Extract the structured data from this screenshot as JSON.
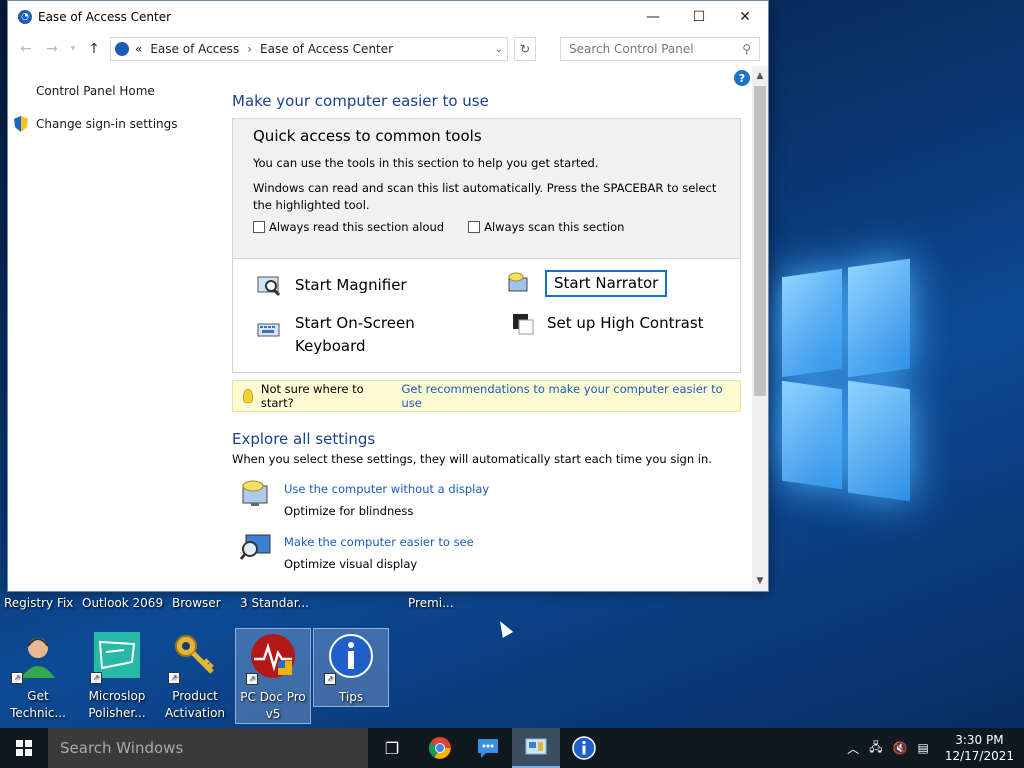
{
  "window": {
    "title": "Ease of Access Center",
    "minimize_icon": "—",
    "maximize_icon": "☐",
    "close_icon": "✕"
  },
  "address": {
    "prefix": "«",
    "crumbs": [
      "Ease of Access",
      "Ease of Access Center"
    ],
    "crumb_sep": "›",
    "search_placeholder": "Search Control Panel"
  },
  "leftnav": {
    "items": [
      {
        "label": "Control Panel Home"
      },
      {
        "label": "Change sign-in settings"
      }
    ]
  },
  "main": {
    "title": "Make your computer easier to use",
    "quick": {
      "heading": "Quick access to common tools",
      "p1": "You can use the tools in this section to help you get started.",
      "p2": "Windows can read and scan this list automatically.  Press the SPACEBAR to select the highlighted tool.",
      "chk_read": "Always read this section aloud",
      "chk_scan": "Always scan this section",
      "tools": [
        {
          "label": "Start Magnifier"
        },
        {
          "label": "Start Narrator"
        },
        {
          "label": "Start On-Screen Keyboard"
        },
        {
          "label": "Set up High Contrast"
        }
      ]
    },
    "tip": {
      "text": "Not sure where to start?",
      "link": "Get recommendations to make your computer easier to use"
    },
    "explore": {
      "title": "Explore all settings",
      "subtitle": "When you select these settings, they will automatically start each time you sign in.",
      "settings": [
        {
          "link": "Use the computer without a display",
          "desc": "Optimize for blindness"
        },
        {
          "link": "Make the computer easier to see",
          "desc": "Optimize visual display"
        }
      ]
    }
  },
  "desktop": {
    "row1": [
      "Registry Fix",
      "Outlook 2069",
      "Browser",
      "3 Standar...",
      "Premi..."
    ],
    "icons": [
      {
        "label1": "Get",
        "label2": "Technic..."
      },
      {
        "label1": "Microslop",
        "label2": "Polisher..."
      },
      {
        "label1": "Product",
        "label2": "Activation"
      },
      {
        "label1": "PC Doc Pro",
        "label2": "v5"
      },
      {
        "label1": "Tips",
        "label2": ""
      }
    ]
  },
  "taskbar": {
    "search_placeholder": "Search Windows",
    "time": "3:30 PM",
    "date": "12/17/2021"
  },
  "colors": {
    "link": "#1a5dbf",
    "heading": "#1b3f8f",
    "focus": "#1a6fc6"
  }
}
